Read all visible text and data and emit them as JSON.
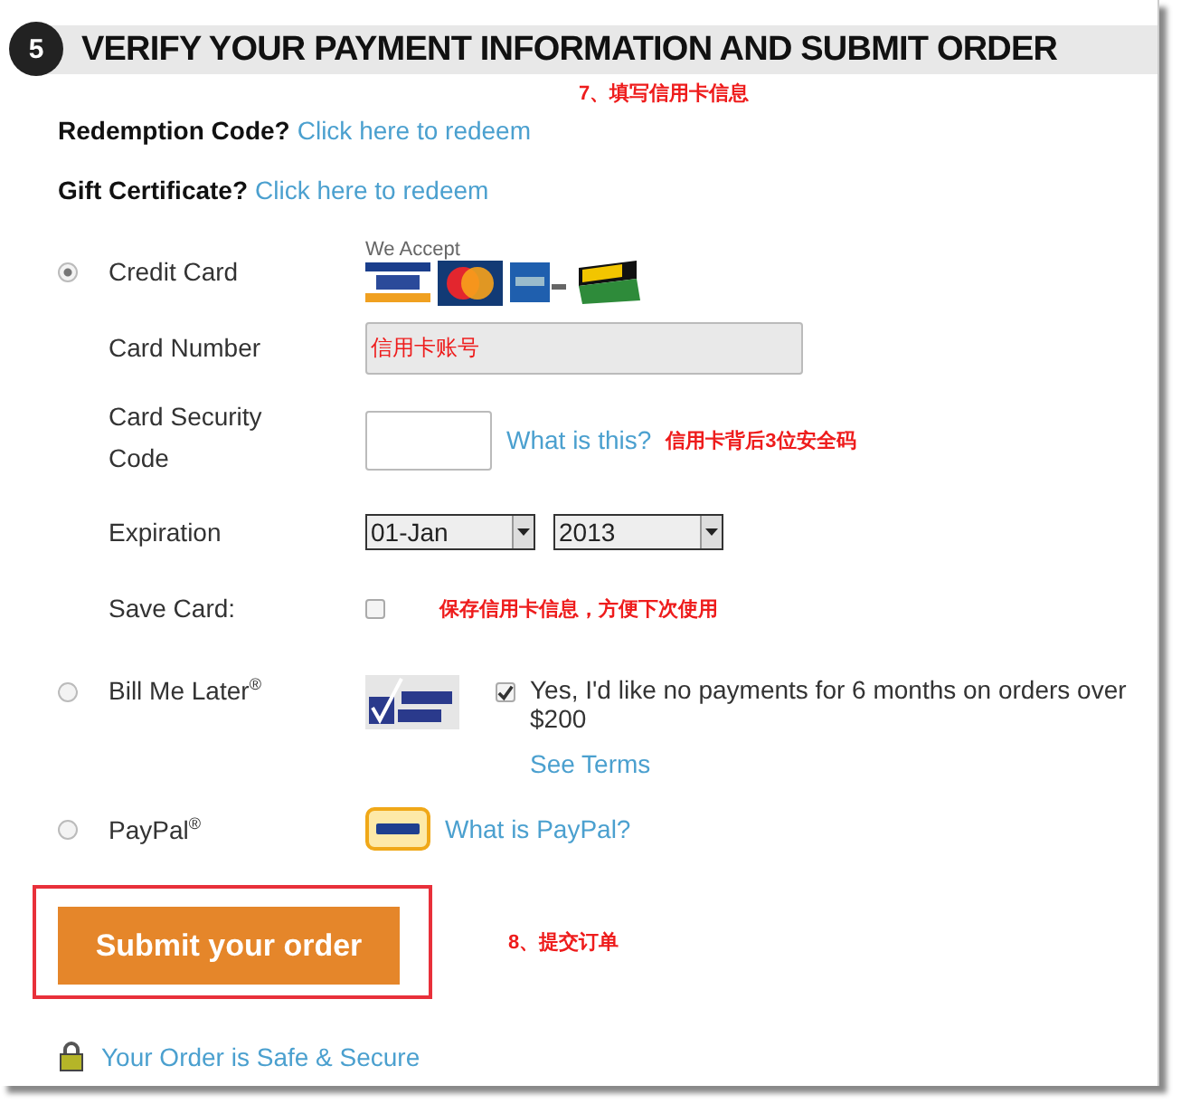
{
  "section": {
    "number": "5",
    "title": "VERIFY YOUR PAYMENT INFORMATION AND SUBMIT ORDER",
    "note": "7、填写信用卡信息"
  },
  "redeem_links": [
    {
      "label": "Redemption Code?",
      "link": "Click here to redeem"
    },
    {
      "label": "Gift Certificate?",
      "link": "Click here to redeem"
    }
  ],
  "credit_card": {
    "label": "Credit Card",
    "selected": true,
    "accept_label": "We Accept",
    "card_number": {
      "label": "Card Number",
      "value": "信用卡账号"
    },
    "security_code": {
      "label": "Card Security Code",
      "help_link": "What is this?",
      "note": "信用卡背后3位安全码"
    },
    "expiration": {
      "label": "Expiration",
      "month": "01-Jan",
      "year": "2013"
    },
    "save_card": {
      "label": "Save Card:",
      "checked": false,
      "note": "保存信用卡信息，方便下次使用"
    }
  },
  "bill_me_later": {
    "label": "Bill Me Later$^{®}$",
    "selected": false,
    "offer": "Yes, I'd like no payments for 6 months on orders over $200",
    "offer_checked": true,
    "terms_link": "See Terms"
  },
  "paypal": {
    "label": "PayPal$^{®}$",
    "selected": false,
    "help_link": "What is PayPal?"
  },
  "submit": {
    "label": "Submit your order",
    "note": "8、提交订单"
  },
  "secure_link": "Your Order is Safe & Secure"
}
